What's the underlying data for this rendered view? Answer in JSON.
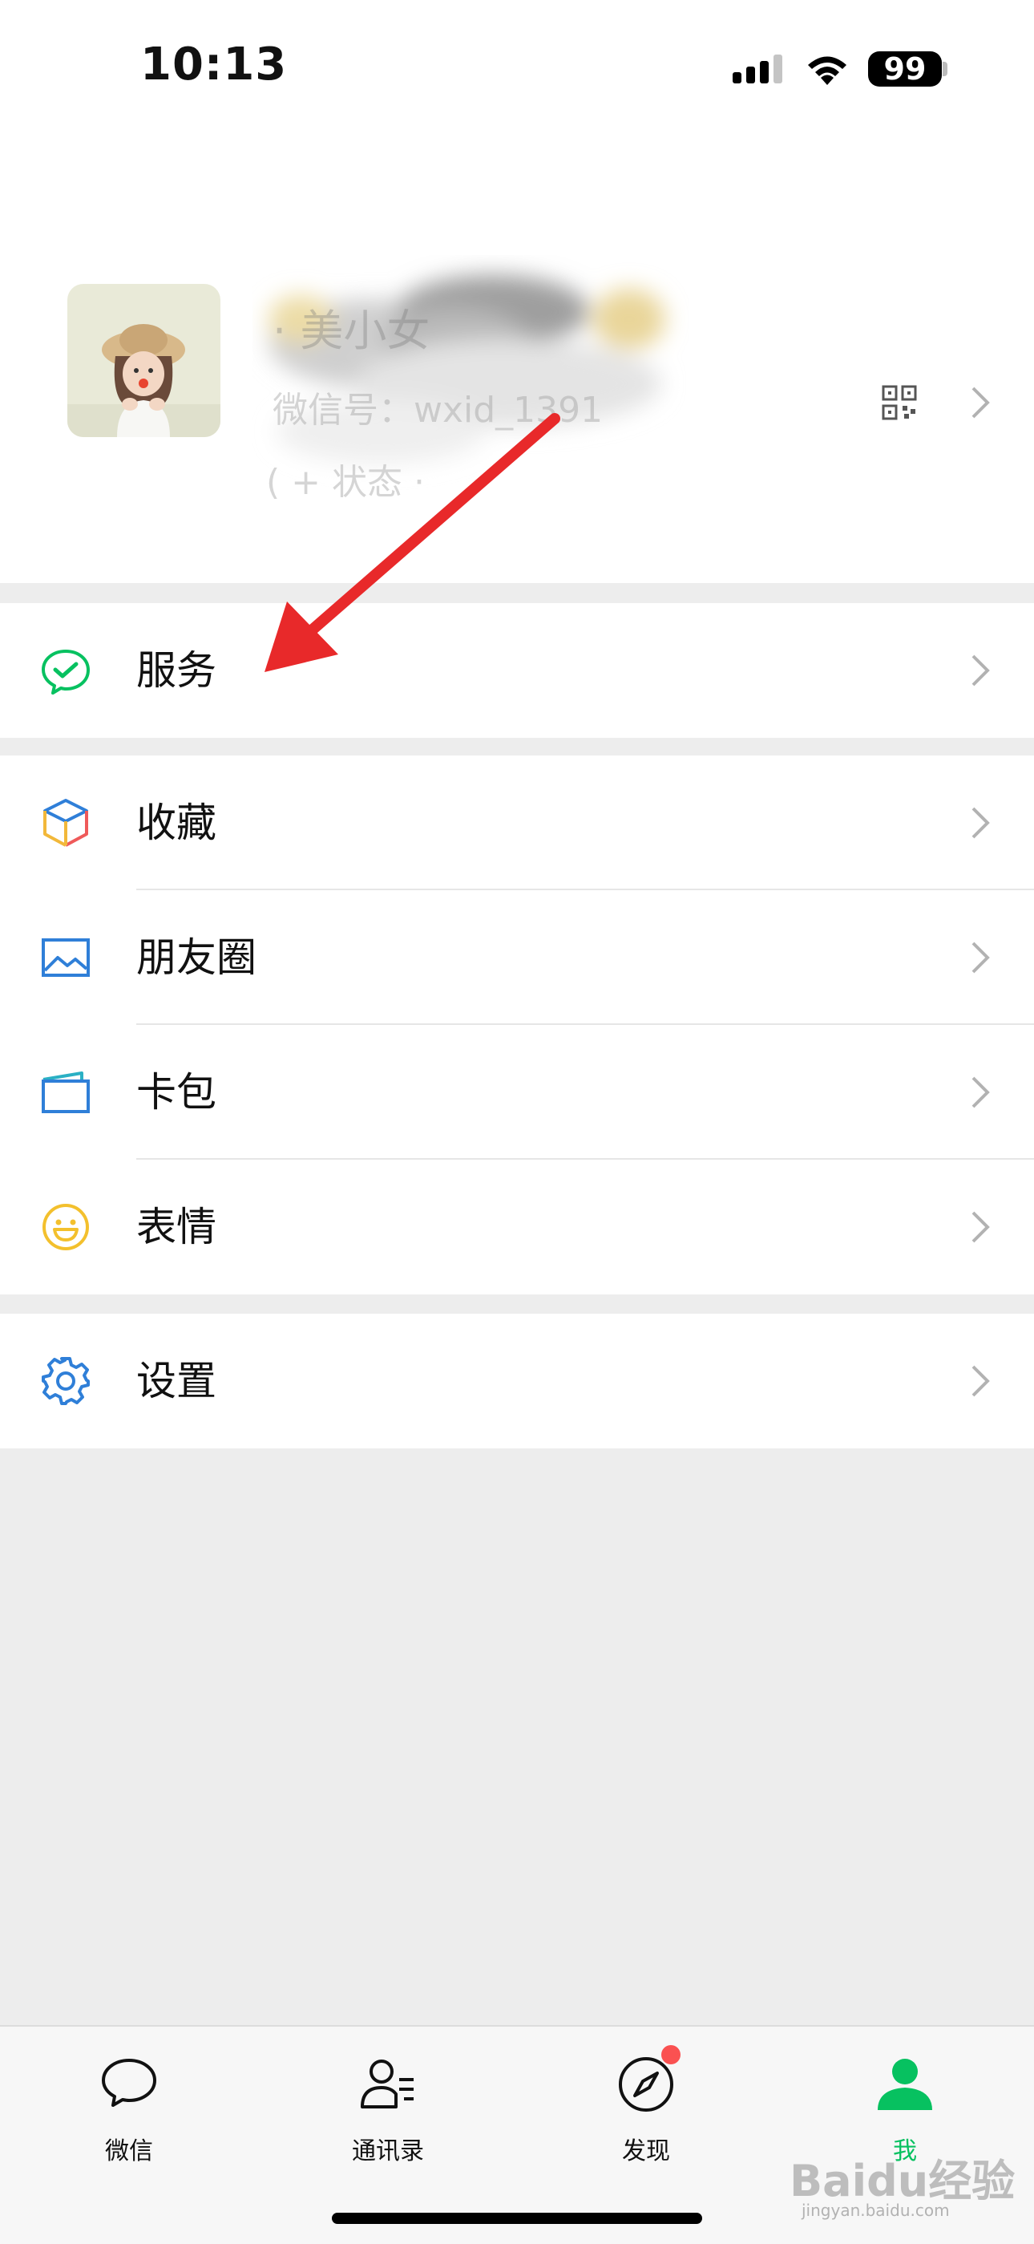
{
  "status_bar": {
    "time": "10:13",
    "battery": "99"
  },
  "profile": {
    "name": "· 美小女",
    "wechat_id": "微信号：wxid_1391",
    "status": "(  + 状态  ·"
  },
  "menu": {
    "services": {
      "label": "服务",
      "icon": "wechat-pay-icon"
    },
    "favorites": {
      "label": "收藏",
      "icon": "favorites-cube-icon"
    },
    "moments": {
      "label": "朋友圈",
      "icon": "moments-photo-icon"
    },
    "cards": {
      "label": "卡包",
      "icon": "card-wallet-icon"
    },
    "stickers": {
      "label": "表情",
      "icon": "smiley-icon"
    },
    "settings": {
      "label": "设置",
      "icon": "gear-icon"
    }
  },
  "tabbar": {
    "tabs": [
      {
        "label": "微信",
        "icon": "chat-bubble-icon"
      },
      {
        "label": "通讯录",
        "icon": "contacts-icon"
      },
      {
        "label": "发现",
        "icon": "compass-icon"
      },
      {
        "label": "我",
        "icon": "person-icon",
        "active": true
      }
    ]
  },
  "watermark": {
    "brand": "Baidu经验",
    "url": "jingyan.baidu.com"
  },
  "colors": {
    "wechat_green": "#07c160",
    "arrow_red": "#e8292a",
    "badge_red": "#fa5151",
    "background": "#ededed"
  }
}
